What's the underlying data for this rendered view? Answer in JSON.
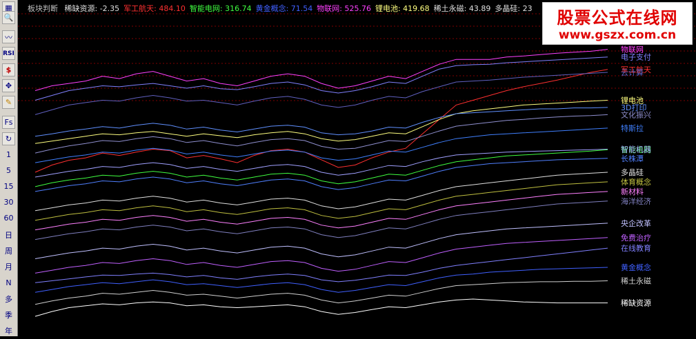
{
  "header": {
    "title": "板块判断",
    "items": [
      {
        "label": "稀缺资源:",
        "value": "-2.35",
        "color": "#e0e0e0"
      },
      {
        "label": "军工航天:",
        "value": "484.10",
        "color": "#ff3030"
      },
      {
        "label": "智能电网:",
        "value": "316.74",
        "color": "#40ff40"
      },
      {
        "label": "黄金概念:",
        "value": "71.54",
        "color": "#4060ff"
      },
      {
        "label": "物联网:",
        "value": "525.76",
        "color": "#ff40ff"
      },
      {
        "label": "锂电池:",
        "value": "419.68",
        "color": "#ffff80"
      },
      {
        "label": "稀土永磁:",
        "value": "43.89",
        "color": "#e0e0e0"
      },
      {
        "label": "多晶硅:",
        "value": "23",
        "color": "#e0e0e0"
      }
    ]
  },
  "watermark": {
    "title": "股票公式在线网",
    "url": "www.gszx.com.cn"
  },
  "toolbar": {
    "icons": [
      "grid-icon",
      "zoom-icon",
      "line-chart-icon",
      "rsi-icon",
      "dollar-icon",
      "move-icon",
      "pencil-icon",
      "fs-icon",
      "refresh-icon"
    ],
    "rsi_label": "RSI",
    "fs_label": "Fs",
    "periods": [
      "1",
      "5",
      "15",
      "30",
      "60",
      "日",
      "周",
      "月",
      "N",
      "多",
      "季",
      "年"
    ]
  },
  "colors": {
    "background": "#000000",
    "grid": "#800000",
    "toolbar": "#d8d4cc"
  },
  "chart_data": {
    "type": "line",
    "title": "板块判断",
    "xlabel": "",
    "ylabel": "",
    "grid": true,
    "x": [
      1,
      2,
      3,
      4,
      5,
      6,
      7,
      8,
      9,
      10,
      11,
      12,
      13,
      14,
      15,
      16,
      17,
      18,
      19,
      20,
      21,
      22,
      23,
      24,
      25,
      26,
      27,
      28,
      29,
      30,
      31,
      32,
      33,
      34,
      35
    ],
    "ylim": [
      -60,
      600
    ],
    "series": [
      {
        "name": "物联网",
        "color": "#ff40ff",
        "values": [
          440,
          450,
          455,
          460,
          470,
          465,
          475,
          480,
          470,
          460,
          465,
          455,
          450,
          460,
          470,
          475,
          470,
          455,
          445,
          450,
          460,
          470,
          465,
          480,
          495,
          505,
          505,
          505,
          510,
          512,
          515,
          518,
          520,
          522,
          526
        ]
      },
      {
        "name": "电子支付",
        "color": "#8080ff",
        "values": [
          420,
          430,
          440,
          445,
          450,
          448,
          452,
          455,
          450,
          445,
          450,
          444,
          442,
          448,
          455,
          458,
          452,
          440,
          435,
          440,
          448,
          458,
          455,
          470,
          485,
          492,
          494,
          495,
          498,
          500,
          502,
          504,
          506,
          508,
          510
        ]
      },
      {
        "name": "军工航天",
        "color": "#ff3030",
        "values": [
          270,
          285,
          295,
          300,
          310,
          305,
          312,
          318,
          315,
          300,
          305,
          298,
          290,
          305,
          315,
          318,
          312,
          296,
          280,
          285,
          300,
          312,
          320,
          350,
          380,
          410,
          420,
          430,
          440,
          448,
          455,
          462,
          470,
          478,
          484
        ]
      },
      {
        "name": "云计算",
        "color": "#6060c0",
        "values": [
          390,
          400,
          410,
          415,
          420,
          418,
          425,
          430,
          425,
          418,
          420,
          415,
          410,
          418,
          425,
          428,
          422,
          410,
          405,
          410,
          420,
          428,
          425,
          438,
          448,
          458,
          460,
          462,
          465,
          468,
          470,
          472,
          474,
          476,
          478
        ]
      },
      {
        "name": "锂电池",
        "color": "#ffff80",
        "values": [
          330,
          335,
          340,
          345,
          350,
          348,
          352,
          355,
          350,
          345,
          350,
          346,
          342,
          348,
          352,
          355,
          350,
          340,
          335,
          338,
          345,
          352,
          350,
          365,
          380,
          392,
          398,
          402,
          406,
          410,
          412,
          414,
          416,
          418,
          420
        ]
      },
      {
        "name": "3D打印",
        "color": "#6090ff",
        "values": [
          345,
          350,
          356,
          360,
          365,
          362,
          368,
          372,
          368,
          360,
          364,
          358,
          354,
          360,
          366,
          368,
          364,
          352,
          348,
          350,
          356,
          364,
          362,
          374,
          384,
          392,
          394,
          396,
          398,
          400,
          402,
          402,
          404,
          404,
          405
        ]
      },
      {
        "name": "文化振兴",
        "color": "#9090d0",
        "values": [
          310,
          318,
          325,
          330,
          336,
          334,
          340,
          344,
          340,
          332,
          336,
          330,
          325,
          332,
          338,
          340,
          336,
          324,
          318,
          320,
          328,
          336,
          334,
          345,
          356,
          366,
          370,
          374,
          378,
          380,
          383,
          385,
          387,
          388,
          390
        ]
      },
      {
        "name": "特斯拉",
        "color": "#4080ff",
        "values": [
          290,
          296,
          302,
          306,
          312,
          310,
          316,
          320,
          316,
          308,
          312,
          306,
          302,
          308,
          314,
          316,
          312,
          300,
          295,
          298,
          306,
          314,
          312,
          322,
          332,
          340,
          344,
          348,
          350,
          352,
          354,
          356,
          358,
          360,
          362
        ]
      },
      {
        "name": "智能电网",
        "color": "#40ff40",
        "values": [
          240,
          248,
          254,
          258,
          264,
          262,
          268,
          272,
          268,
          260,
          264,
          258,
          254,
          260,
          266,
          268,
          264,
          252,
          246,
          250,
          258,
          266,
          264,
          274,
          284,
          292,
          296,
          300,
          304,
          306,
          308,
          310,
          312,
          314,
          317
        ]
      },
      {
        "name": "智能机器",
        "color": "#a0a0ff",
        "values": [
          260,
          266,
          272,
          276,
          282,
          280,
          286,
          290,
          286,
          278,
          282,
          276,
          272,
          278,
          284,
          286,
          282,
          270,
          264,
          268,
          276,
          284,
          282,
          292,
          300,
          306,
          308,
          310,
          312,
          313,
          314,
          315,
          316,
          317,
          318
        ]
      },
      {
        "name": "长株潭",
        "color": "#5080ff",
        "values": [
          230,
          236,
          242,
          246,
          252,
          250,
          256,
          260,
          256,
          248,
          252,
          246,
          242,
          248,
          254,
          256,
          252,
          240,
          234,
          238,
          246,
          254,
          252,
          262,
          272,
          280,
          284,
          288,
          290,
          292,
          294,
          296,
          297,
          298,
          299
        ]
      },
      {
        "name": "多晶硅",
        "color": "#e0e0e0",
        "values": [
          190,
          196,
          202,
          206,
          212,
          210,
          216,
          220,
          216,
          208,
          212,
          206,
          202,
          208,
          214,
          216,
          212,
          200,
          194,
          198,
          206,
          214,
          212,
          222,
          232,
          240,
          244,
          248,
          252,
          256,
          260,
          264,
          266,
          268,
          270
        ]
      },
      {
        "name": "体育概念",
        "color": "#c0c040",
        "values": [
          170,
          176,
          182,
          186,
          192,
          190,
          196,
          200,
          196,
          188,
          192,
          186,
          182,
          188,
          194,
          196,
          192,
          180,
          174,
          178,
          186,
          194,
          192,
          202,
          212,
          220,
          224,
          228,
          232,
          236,
          240,
          244,
          246,
          248,
          250
        ]
      },
      {
        "name": "新材料",
        "color": "#ff80ff",
        "values": [
          150,
          156,
          162,
          166,
          172,
          170,
          176,
          180,
          176,
          168,
          172,
          166,
          162,
          168,
          174,
          176,
          172,
          160,
          154,
          158,
          166,
          174,
          172,
          182,
          192,
          200,
          204,
          208,
          212,
          216,
          220,
          224,
          226,
          228,
          230
        ]
      },
      {
        "name": "海洋经济",
        "color": "#8080c0",
        "values": [
          130,
          136,
          142,
          146,
          152,
          150,
          156,
          160,
          156,
          148,
          152,
          146,
          142,
          148,
          154,
          156,
          152,
          140,
          134,
          138,
          146,
          154,
          152,
          162,
          172,
          180,
          184,
          188,
          192,
          196,
          200,
          204,
          206,
          208,
          210
        ]
      },
      {
        "name": "央企改革",
        "color": "#c0c0ff",
        "values": [
          90,
          96,
          102,
          106,
          112,
          110,
          116,
          120,
          116,
          108,
          112,
          106,
          102,
          108,
          114,
          116,
          112,
          100,
          94,
          98,
          106,
          114,
          112,
          122,
          132,
          140,
          144,
          148,
          152,
          154,
          156,
          158,
          160,
          162,
          164
        ]
      },
      {
        "name": "免费治疗",
        "color": "#c060ff",
        "values": [
          60,
          66,
          72,
          76,
          82,
          80,
          86,
          90,
          86,
          78,
          82,
          76,
          72,
          78,
          84,
          86,
          82,
          70,
          64,
          68,
          76,
          84,
          82,
          92,
          102,
          110,
          114,
          118,
          122,
          124,
          126,
          128,
          130,
          132,
          134
        ]
      },
      {
        "name": "在线教育",
        "color": "#8080ff",
        "values": [
          40,
          44,
          48,
          52,
          56,
          55,
          58,
          60,
          57,
          52,
          55,
          50,
          47,
          52,
          56,
          58,
          55,
          46,
          42,
          45,
          50,
          56,
          55,
          62,
          70,
          76,
          80,
          84,
          88,
          92,
          96,
          100,
          104,
          108,
          112
        ]
      },
      {
        "name": "黄金概念",
        "color": "#4060ff",
        "values": [
          20,
          26,
          32,
          36,
          40,
          38,
          42,
          46,
          42,
          36,
          38,
          34,
          30,
          34,
          38,
          40,
          36,
          26,
          20,
          24,
          30,
          36,
          34,
          42,
          50,
          56,
          58,
          62,
          64,
          66,
          68,
          69,
          70,
          71,
          72
        ]
      },
      {
        "name": "稀土永磁",
        "color": "#d0d0d0",
        "values": [
          -5,
          2,
          8,
          12,
          18,
          16,
          20,
          24,
          20,
          14,
          16,
          12,
          8,
          12,
          16,
          18,
          14,
          4,
          -2,
          2,
          8,
          14,
          12,
          20,
          28,
          34,
          36,
          38,
          40,
          41,
          42,
          42,
          43,
          43,
          44
        ]
      },
      {
        "name": "稀缺资源",
        "color": "#ffffff",
        "values": [
          -30,
          -20,
          -12,
          -8,
          -4,
          -6,
          -2,
          0,
          -2,
          -8,
          -6,
          -10,
          -12,
          -10,
          -8,
          -6,
          -10,
          -20,
          -26,
          -22,
          -16,
          -10,
          -12,
          -6,
          0,
          4,
          6,
          4,
          2,
          0,
          -1,
          -2,
          -2,
          -2,
          -2
        ]
      }
    ]
  }
}
